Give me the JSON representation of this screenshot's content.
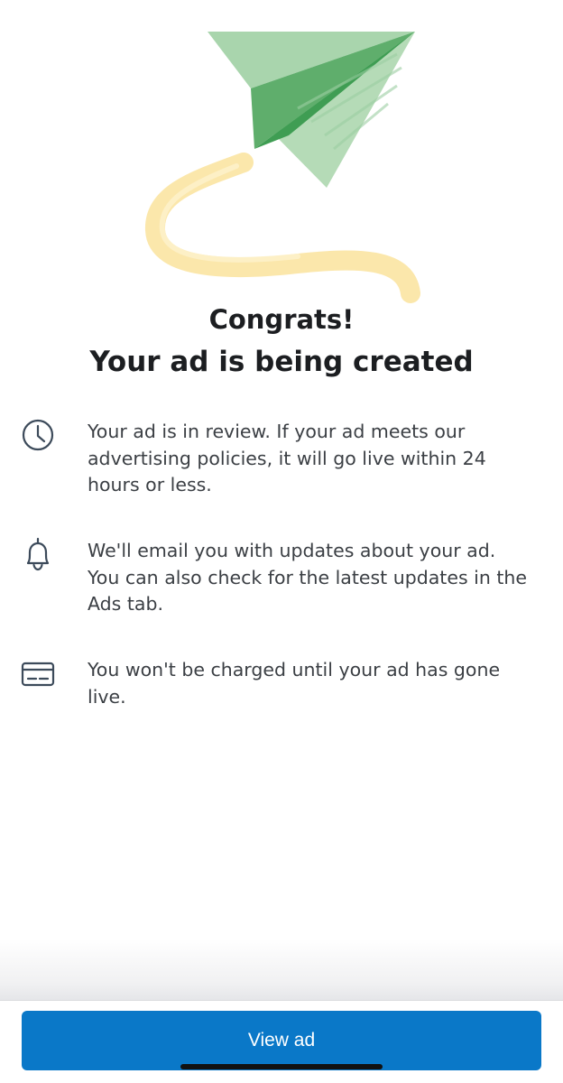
{
  "illustration": {
    "icon": "paper-plane-illustration",
    "plane_colors": [
      "#a9d5ad",
      "#6cb877",
      "#3f9d53"
    ],
    "trail_color": "#fbe6a6"
  },
  "header": {
    "title_line1": "Congrats!",
    "title_line2": "Your ad is being created"
  },
  "info": {
    "items": [
      {
        "icon": "clock-icon",
        "text": "Your ad is in review. If your ad meets our advertising policies, it will go live within 24 hours or less."
      },
      {
        "icon": "bell-icon",
        "text": "We'll email you with updates about your ad. You can also check for the latest updates in the Ads tab."
      },
      {
        "icon": "credit-card-icon",
        "text": "You won't be charged until your ad has gone live."
      }
    ]
  },
  "footer": {
    "button_label": "View ad",
    "button_color": "#0a78c8"
  }
}
